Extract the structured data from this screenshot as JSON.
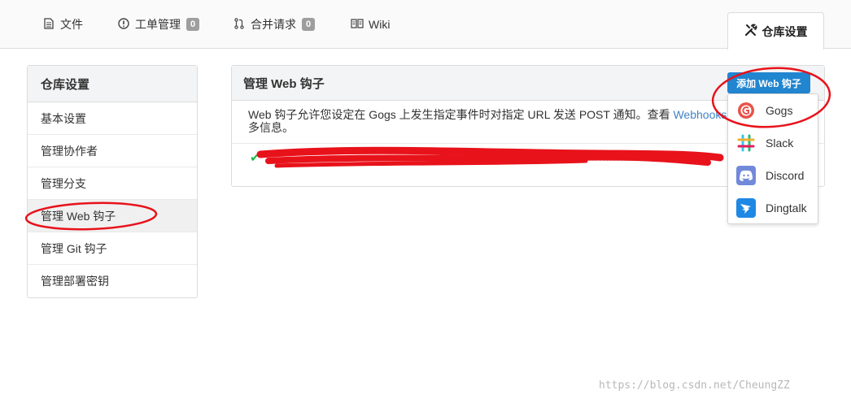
{
  "tabs": [
    {
      "label": "文件",
      "icon": "file-icon"
    },
    {
      "label": "工单管理",
      "count": "0",
      "icon": "issue-icon"
    },
    {
      "label": "合并请求",
      "count": "0",
      "icon": "pull-request-icon"
    },
    {
      "label": "Wiki",
      "icon": "book-icon"
    }
  ],
  "active_tab": {
    "label": "仓库设置",
    "icon": "wrench-screwdriver-icon"
  },
  "sidebar": {
    "title": "仓库设置",
    "items": [
      {
        "label": "基本设置"
      },
      {
        "label": "管理协作者"
      },
      {
        "label": "管理分支"
      },
      {
        "label": "管理 Web 钩子"
      },
      {
        "label": "管理 Git 钩子"
      },
      {
        "label": "管理部署密钥"
      }
    ],
    "active_index": 3
  },
  "panel": {
    "title": "管理 Web 钩子",
    "desc_prefix": "Web 钩子允许您设定在 Gogs 上发生指定事件时对指定 URL 发送 POST 通知。查看 ",
    "desc_link": "Webhooks",
    "desc_suffix": "多信息。"
  },
  "add_button": {
    "label": "添加 Web 钩子"
  },
  "dropdown": {
    "items": [
      {
        "label": "Gogs",
        "icon": "gogs-icon"
      },
      {
        "label": "Slack",
        "icon": "slack-icon"
      },
      {
        "label": "Discord",
        "icon": "discord-icon"
      },
      {
        "label": "Dingtalk",
        "icon": "dingtalk-icon"
      }
    ]
  },
  "watermark": "https://blog.csdn.net/CheungZZ",
  "colors": {
    "primary": "#2185d0",
    "annotation": "#e8121b",
    "link": "#4183c4"
  }
}
